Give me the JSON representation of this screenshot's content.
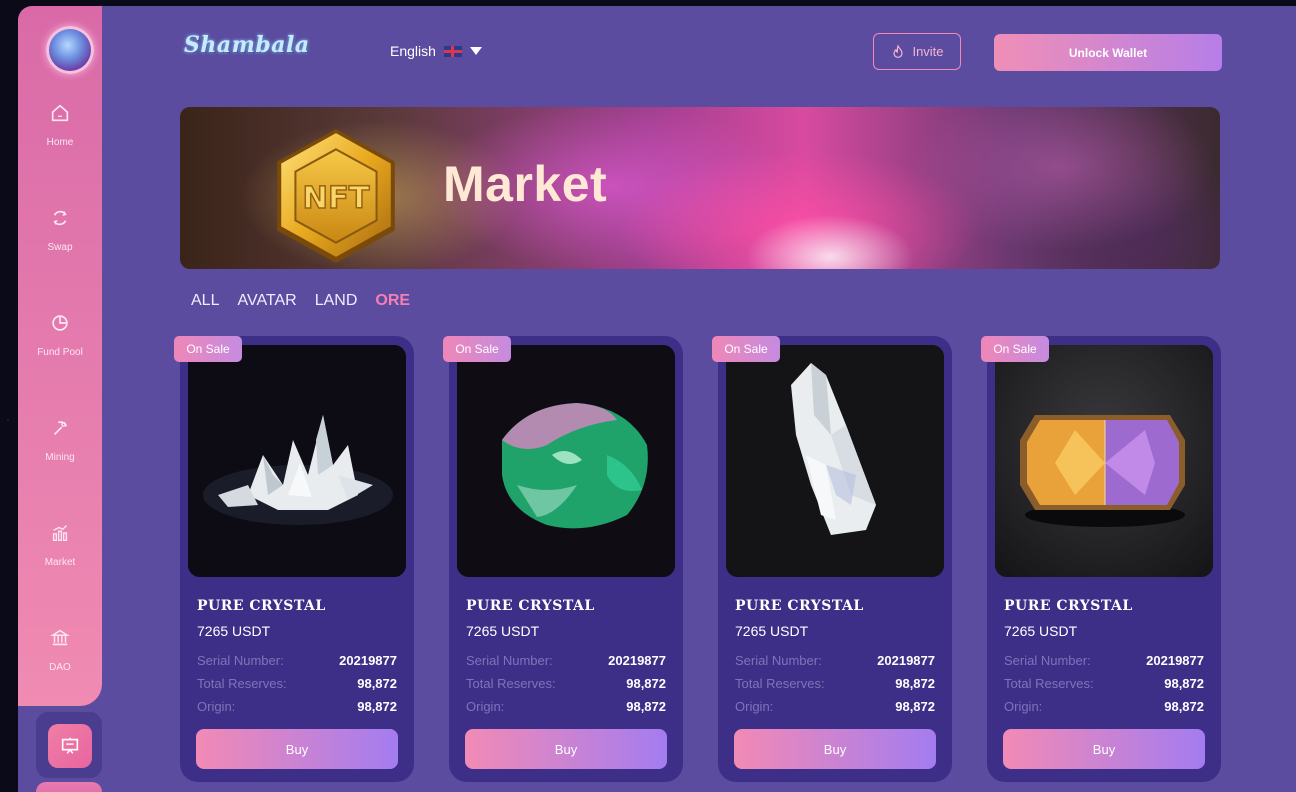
{
  "brand": "Shambala",
  "header": {
    "language": "English",
    "invite_label": "Invite",
    "unlock_label": "Unlock Wallet"
  },
  "sidebar": {
    "items": [
      {
        "label": "Home",
        "icon": "home-icon"
      },
      {
        "label": "Swap",
        "icon": "swap-icon"
      },
      {
        "label": "Fund Pool",
        "icon": "pie-chart-icon"
      },
      {
        "label": "Mining",
        "icon": "pickaxe-icon"
      },
      {
        "label": "Market",
        "icon": "market-chart-icon"
      },
      {
        "label": "DAO",
        "icon": "bank-icon"
      }
    ],
    "active_icon": "presentation-board-icon"
  },
  "banner": {
    "badge_text": "NFT",
    "title": "Market"
  },
  "filters": [
    "ALL",
    "AVATAR",
    "LAND",
    "ORE"
  ],
  "active_filter": "ORE",
  "cards": [
    {
      "badge": "On Sale",
      "name": "PURE CRYSTAL",
      "price": "7265 USDT",
      "serial_label": "Serial Number:",
      "serial": "20219877",
      "reserves_label": "Total Reserves:",
      "reserves": "98,872",
      "origin_label": "Origin:",
      "origin": "98,872",
      "buy": "Buy"
    },
    {
      "badge": "On Sale",
      "name": "PURE CRYSTAL",
      "price": "7265 USDT",
      "serial_label": "Serial Number:",
      "serial": "20219877",
      "reserves_label": "Total Reserves:",
      "reserves": "98,872",
      "origin_label": "Origin:",
      "origin": "98,872",
      "buy": "Buy"
    },
    {
      "badge": "On Sale",
      "name": "PURE CRYSTAL",
      "price": "7265 USDT",
      "serial_label": "Serial Number:",
      "serial": "20219877",
      "reserves_label": "Total Reserves:",
      "reserves": "98,872",
      "origin_label": "Origin:",
      "origin": "98,872",
      "buy": "Buy"
    },
    {
      "badge": "On Sale",
      "name": "PURE CRYSTAL",
      "price": "7265 USDT",
      "serial_label": "Serial Number:",
      "serial": "20219877",
      "reserves_label": "Total Reserves:",
      "reserves": "98,872",
      "origin_label": "Origin:",
      "origin": "98,872",
      "buy": "Buy"
    }
  ],
  "colors": {
    "background": "#5b4ca0",
    "sidebar_pink": "#e379ad",
    "card": "#3d2f88",
    "accent_pink": "#f47fb7"
  }
}
